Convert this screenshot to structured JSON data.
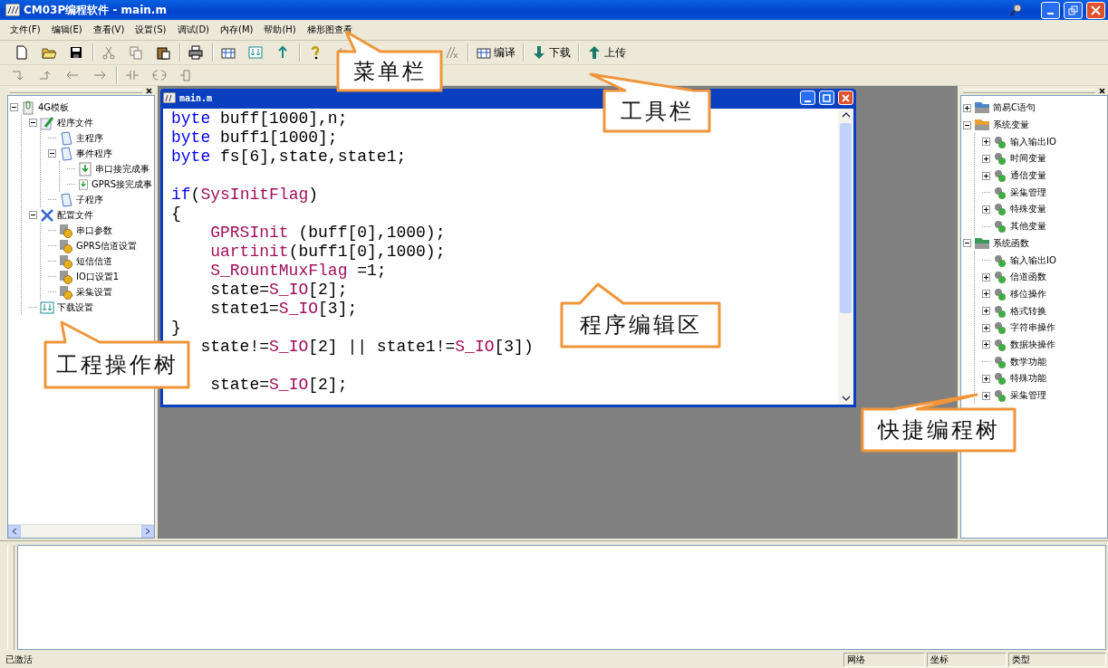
{
  "window": {
    "title": "CM03P编程软件 - main.m"
  },
  "menu": [
    "文件(F)",
    "编辑(E)",
    "查看(V)",
    "设置(S)",
    "调试(D)",
    "内存(M)",
    "帮助(H)",
    "梯形图查看"
  ],
  "toolbar": [
    {
      "kind": "icon",
      "disabled": false
    },
    {
      "kind": "icon",
      "disabled": false
    },
    {
      "kind": "icon",
      "disabled": false
    },
    {
      "kind": "sep"
    },
    {
      "kind": "icon",
      "disabled": true
    },
    {
      "kind": "icon",
      "disabled": true
    },
    {
      "kind": "icon",
      "disabled": false
    },
    {
      "kind": "sep"
    },
    {
      "kind": "icon",
      "disabled": false
    },
    {
      "kind": "sep"
    },
    {
      "kind": "icon",
      "disabled": false
    },
    {
      "kind": "icon",
      "disabled": false
    },
    {
      "kind": "icon",
      "disabled": false
    },
    {
      "kind": "sep"
    },
    {
      "kind": "icon",
      "disabled": false
    },
    {
      "kind": "icon",
      "disabled": true
    },
    {
      "kind": "gap"
    },
    {
      "kind": "icon",
      "disabled": true
    },
    {
      "kind": "sep"
    },
    {
      "kind": "text",
      "label": "编译",
      "disabled": false
    },
    {
      "kind": "sep"
    },
    {
      "kind": "text",
      "label": "下载",
      "disabled": false
    },
    {
      "kind": "sep"
    },
    {
      "kind": "text",
      "label": "上传",
      "disabled": false
    }
  ],
  "ladder_toolbar": [
    {
      "kind": "icon",
      "disabled": true
    },
    {
      "kind": "icon",
      "disabled": true
    },
    {
      "kind": "icon",
      "disabled": true
    },
    {
      "kind": "icon",
      "disabled": true
    },
    {
      "kind": "sep"
    },
    {
      "kind": "icon",
      "disabled": true
    },
    {
      "kind": "icon",
      "disabled": true
    },
    {
      "kind": "icon",
      "disabled": true
    }
  ],
  "project_tree": [
    {
      "label": "4G模板",
      "kind": "project",
      "expanded": true,
      "children": [
        {
          "label": "程序文件",
          "kind": "edit",
          "expanded": true,
          "children": [
            {
              "label": "主程序",
              "kind": "page"
            },
            {
              "label": "事件程序",
              "kind": "page",
              "expanded": true,
              "children": [
                {
                  "label": "串口接完成事",
                  "kind": "event"
                },
                {
                  "label": "GPRS接完成事",
                  "kind": "event"
                }
              ]
            },
            {
              "label": "子程序",
              "kind": "page"
            }
          ]
        },
        {
          "label": "配置文件",
          "kind": "tools",
          "expanded": true,
          "children": [
            {
              "label": "串口参数",
              "kind": "setting"
            },
            {
              "label": "GPRS信道设置",
              "kind": "setting"
            },
            {
              "label": "短信信道",
              "kind": "setting"
            },
            {
              "label": "IO口设置1",
              "kind": "setting"
            },
            {
              "label": "采集设置",
              "kind": "setting"
            }
          ]
        },
        {
          "label": "下载设置",
          "kind": "download"
        }
      ]
    }
  ],
  "editor": {
    "title": "main.m",
    "lines": [
      {
        "tokens": [
          {
            "kind": "keyword",
            "text": "byte"
          },
          {
            "kind": "plain",
            "text": " buff[1000],n;"
          }
        ]
      },
      {
        "tokens": [
          {
            "kind": "keyword",
            "text": "byte"
          },
          {
            "kind": "plain",
            "text": " buff1[1000];"
          }
        ]
      },
      {
        "tokens": [
          {
            "kind": "keyword",
            "text": "byte"
          },
          {
            "kind": "plain",
            "text": " fs[6],state,state1;"
          }
        ]
      },
      {
        "space_before": true,
        "tokens": [
          {
            "kind": "keyword",
            "text": "if"
          },
          {
            "kind": "plain",
            "text": "("
          },
          {
            "kind": "symbol",
            "text": "SysInitFlag"
          },
          {
            "kind": "plain",
            "text": ")"
          }
        ]
      },
      {
        "tokens": [
          {
            "kind": "plain",
            "text": "{"
          }
        ]
      },
      {
        "tokens": [
          {
            "kind": "symbol",
            "text": "    GPRSInit"
          },
          {
            "kind": "plain",
            "text": " (buff[0],1000);"
          }
        ]
      },
      {
        "tokens": [
          {
            "kind": "symbol",
            "text": "    uartinit"
          },
          {
            "kind": "plain",
            "text": "(buff1[0],1000);"
          }
        ]
      },
      {
        "tokens": [
          {
            "kind": "symbol",
            "text": "    S_RountMuxFlag"
          },
          {
            "kind": "plain",
            "text": " =1;"
          }
        ]
      },
      {
        "tokens": [
          {
            "kind": "plain",
            "text": "    state="
          },
          {
            "kind": "symbol",
            "text": "S_IO"
          },
          {
            "kind": "plain",
            "text": "[2];"
          }
        ]
      },
      {
        "tokens": [
          {
            "kind": "plain",
            "text": "    state1="
          },
          {
            "kind": "symbol",
            "text": "S_IO"
          },
          {
            "kind": "plain",
            "text": "[3];"
          }
        ]
      },
      {
        "tokens": [
          {
            "kind": "plain",
            "text": "}"
          }
        ]
      },
      {
        "tokens": [
          {
            "kind": "plain",
            "text": "   state!="
          },
          {
            "kind": "symbol",
            "text": "S_IO"
          },
          {
            "kind": "plain",
            "text": "[2] || state1!="
          },
          {
            "kind": "symbol",
            "text": "S_IO"
          },
          {
            "kind": "plain",
            "text": "[3])"
          }
        ]
      },
      {
        "space_before": true,
        "tokens": [
          {
            "kind": "plain",
            "text": "    state="
          },
          {
            "kind": "symbol",
            "text": "S_IO"
          },
          {
            "kind": "plain",
            "text": "[2];"
          }
        ]
      }
    ]
  },
  "shortcut_tree": [
    {
      "label": "简易C语句",
      "kind": "folder",
      "color": "#4a86c8",
      "expanded": false
    },
    {
      "label": "系统变量",
      "kind": "folder",
      "color": "#e8a030",
      "expanded": true,
      "children": [
        {
          "label": "输入输出IO",
          "kind": "group",
          "expanded": false
        },
        {
          "label": "时间变量",
          "kind": "group",
          "expanded": false
        },
        {
          "label": "通信变量",
          "kind": "group",
          "expanded": false
        },
        {
          "label": "采集管理",
          "kind": "group"
        },
        {
          "label": "特殊变量",
          "kind": "group",
          "expanded": false
        },
        {
          "label": "其他变量",
          "kind": "group"
        }
      ]
    },
    {
      "label": "系统函数",
      "kind": "folder",
      "color": "#3a9a5a",
      "expanded": true,
      "children": [
        {
          "label": "输入输出IO",
          "kind": "group"
        },
        {
          "label": "信道函数",
          "kind": "group",
          "expanded": false
        },
        {
          "label": "移位操作",
          "kind": "group",
          "expanded": false
        },
        {
          "label": "格式转换",
          "kind": "group",
          "expanded": false
        },
        {
          "label": "字符串操作",
          "kind": "group",
          "expanded": false
        },
        {
          "label": "数据块操作",
          "kind": "group",
          "expanded": false
        },
        {
          "label": "数学功能",
          "kind": "group"
        },
        {
          "label": "特殊功能",
          "kind": "group",
          "expanded": false
        },
        {
          "label": "采集管理",
          "kind": "group",
          "expanded": false
        }
      ]
    }
  ],
  "callouts": [
    "菜单栏",
    "工具栏",
    "程序编辑区",
    "工程操作树",
    "快捷编程树"
  ],
  "status_bar": {
    "message": "已激活",
    "panes": [
      "网络",
      "坐标",
      "类型"
    ]
  }
}
